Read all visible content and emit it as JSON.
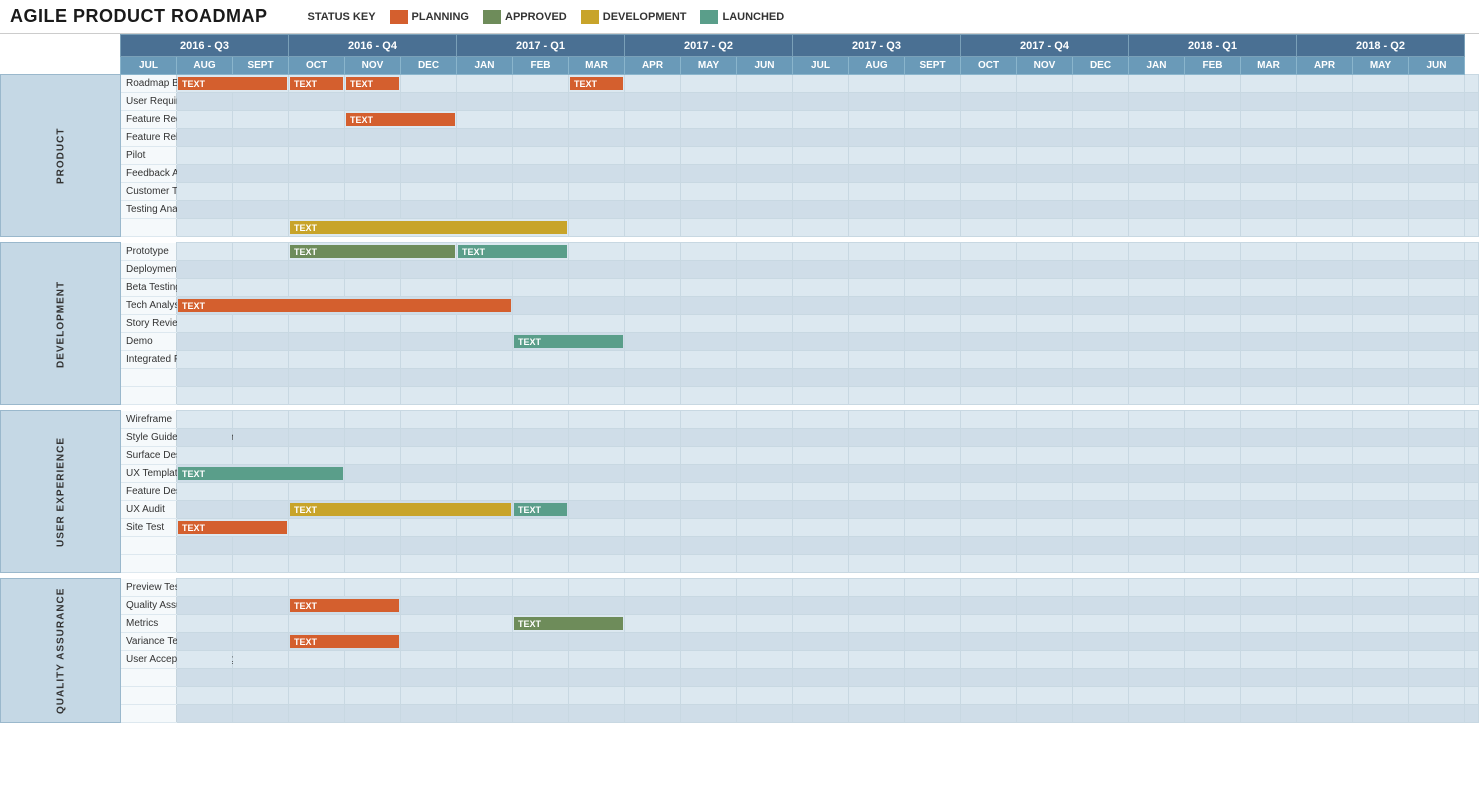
{
  "header": {
    "title": "AGILE PRODUCT ROADMAP",
    "status_key_label": "STATUS KEY",
    "statuses": [
      {
        "label": "PLANNING",
        "color": "#d45f2e"
      },
      {
        "label": "APPROVED",
        "color": "#6e8c5a"
      },
      {
        "label": "DEVELOPMENT",
        "color": "#c8a42a"
      },
      {
        "label": "LAUNCHED",
        "color": "#5a9e8a"
      }
    ]
  },
  "quarters": [
    {
      "label": "2016 - Q3",
      "months": [
        "JUL",
        "AUG",
        "SEPT"
      ],
      "span": 3
    },
    {
      "label": "2016 - Q4",
      "months": [
        "OCT",
        "NOV",
        "DEC"
      ],
      "span": 3
    },
    {
      "label": "2017 - Q1",
      "months": [
        "JAN",
        "FEB",
        "MAR"
      ],
      "span": 3
    },
    {
      "label": "2017 - Q2",
      "months": [
        "APR",
        "MAY",
        "JUN"
      ],
      "span": 3
    },
    {
      "label": "2017 - Q3",
      "months": [
        "JUL",
        "AUG",
        "SEPT"
      ],
      "span": 3
    },
    {
      "label": "2017 - Q4",
      "months": [
        "OCT",
        "NOV",
        "DEC"
      ],
      "span": 3
    },
    {
      "label": "2018 - Q1",
      "months": [
        "JAN",
        "FEB",
        "MAR"
      ],
      "span": 3
    },
    {
      "label": "2018 - Q2",
      "months": [
        "APR",
        "MAY",
        "JUN"
      ],
      "span": 3
    }
  ],
  "sections": [
    {
      "name": "PRODUCT",
      "rows": [
        {
          "label": "Roadmap Brief",
          "bars": [
            {
              "start": 1,
              "span": 2,
              "type": "planning",
              "text": "TEXT"
            },
            {
              "start": 3,
              "span": 1,
              "type": "planning",
              "text": "TEXT"
            },
            {
              "start": 4,
              "span": 1,
              "type": "planning",
              "text": "TEXT"
            },
            {
              "start": 8,
              "span": 1,
              "type": "planning",
              "text": "TEXT"
            }
          ]
        },
        {
          "label": "User Requirements",
          "bars": []
        },
        {
          "label": "Feature Requirements",
          "bars": [
            {
              "start": 4,
              "span": 2,
              "type": "planning",
              "text": "TEXT"
            }
          ]
        },
        {
          "label": "Feature Release",
          "bars": []
        },
        {
          "label": "Pilot",
          "bars": []
        },
        {
          "label": "Feedback Analysis",
          "bars": []
        },
        {
          "label": "Customer Testing",
          "bars": []
        },
        {
          "label": "Testing Analysis",
          "bars": []
        },
        {
          "label": "",
          "bars": [
            {
              "start": 3,
              "span": 5,
              "type": "development",
              "text": "TEXT"
            }
          ]
        }
      ]
    },
    {
      "name": "DEVELOPMENT",
      "rows": [
        {
          "label": "Prototype",
          "bars": [
            {
              "start": 3,
              "span": 3,
              "type": "approved",
              "text": "TEXT"
            },
            {
              "start": 6,
              "span": 2,
              "type": "launched",
              "text": "TEXT"
            }
          ]
        },
        {
          "label": "Deployment",
          "bars": []
        },
        {
          "label": "Beta Testing",
          "bars": []
        },
        {
          "label": "Tech Analysis",
          "bars": [
            {
              "start": 1,
              "span": 6,
              "type": "planning",
              "text": "TEXT"
            }
          ]
        },
        {
          "label": "Story Review",
          "bars": []
        },
        {
          "label": "Demo",
          "bars": [
            {
              "start": 7,
              "span": 2,
              "type": "launched",
              "text": "TEXT"
            }
          ]
        },
        {
          "label": "Integrated Prototype",
          "bars": []
        },
        {
          "label": "",
          "bars": []
        },
        {
          "label": "",
          "bars": []
        }
      ]
    },
    {
      "name": "USER EXPERIENCE",
      "rows": [
        {
          "label": "Wireframe",
          "bars": []
        },
        {
          "label": "Style Guide Development",
          "bars": []
        },
        {
          "label": "Surface Design",
          "bars": []
        },
        {
          "label": "UX Templates",
          "bars": [
            {
              "start": 1,
              "span": 3,
              "type": "launched",
              "text": "TEXT"
            }
          ]
        },
        {
          "label": "Feature Design",
          "bars": []
        },
        {
          "label": "UX Audit",
          "bars": [
            {
              "start": 3,
              "span": 4,
              "type": "development",
              "text": "TEXT"
            },
            {
              "start": 7,
              "span": 1,
              "type": "launched",
              "text": "TEXT"
            }
          ]
        },
        {
          "label": "Site Test",
          "bars": [
            {
              "start": 1,
              "span": 2,
              "type": "planning",
              "text": "TEXT"
            }
          ]
        },
        {
          "label": "",
          "bars": []
        },
        {
          "label": "",
          "bars": []
        }
      ]
    },
    {
      "name": "QUALITY ASSURANCE",
      "rows": [
        {
          "label": "Preview Testing",
          "bars": []
        },
        {
          "label": "Quality Assurance",
          "bars": [
            {
              "start": 3,
              "span": 2,
              "type": "planning",
              "text": "TEXT"
            }
          ]
        },
        {
          "label": "Metrics",
          "bars": [
            {
              "start": 7,
              "span": 2,
              "type": "approved",
              "text": "TEXT"
            }
          ]
        },
        {
          "label": "Variance Testing",
          "bars": [
            {
              "start": 3,
              "span": 2,
              "type": "planning",
              "text": "TEXT"
            }
          ]
        },
        {
          "label": "User Acceptance Testing",
          "bars": []
        },
        {
          "label": "",
          "bars": []
        },
        {
          "label": "",
          "bars": []
        },
        {
          "label": "",
          "bars": []
        }
      ]
    }
  ]
}
